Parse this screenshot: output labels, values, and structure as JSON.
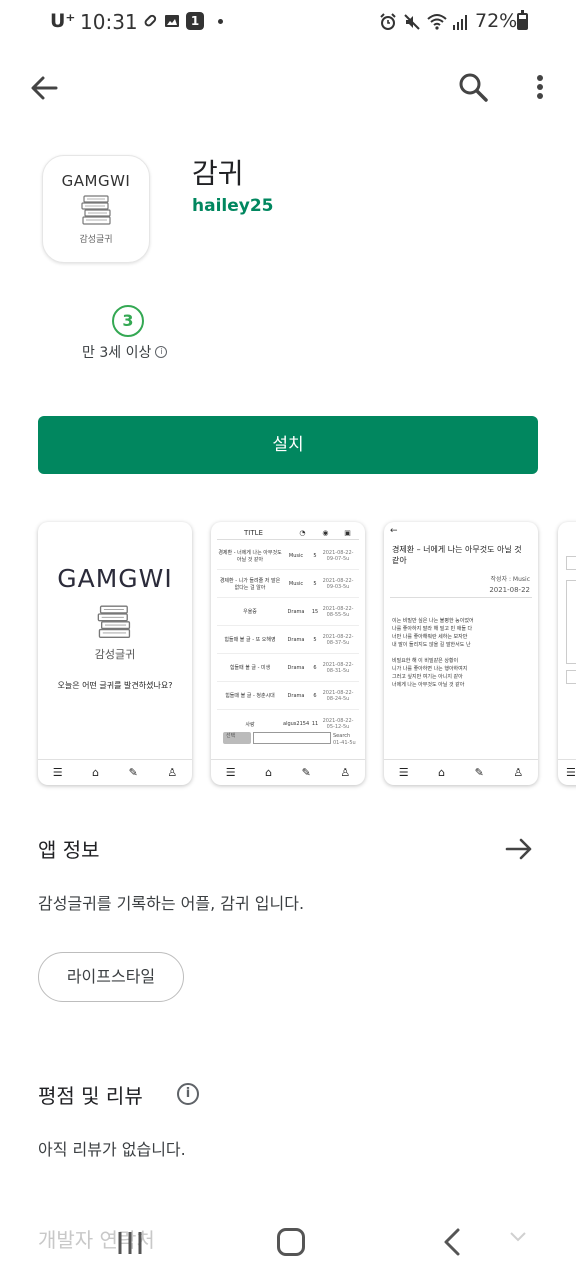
{
  "status_bar": {
    "carrier": "U⁺",
    "time": "10:31",
    "notification_count": "1",
    "battery": "72%",
    "battery_level": 0.72
  },
  "app": {
    "name": "감귀",
    "developer": "hailey25",
    "icon": {
      "title": "GAMGWI",
      "subtitle": "감성글귀"
    }
  },
  "rating": {
    "age_badge": "3",
    "age_label": "만 3세 이상"
  },
  "install_button": "설치",
  "screenshots": {
    "shot1": {
      "title": "GAMGWI",
      "subtitle": "감성글귀",
      "question": "오늘은 어떤 글귀를 발견하셨나요?"
    },
    "shot2": {
      "header_title": "TITLE",
      "rows": [
        {
          "title": "경제환 - 너에게 나는 아무것도 아닐 것 같아",
          "genre": "Music",
          "count": "5",
          "date": "2021-08-22-09-07-5u"
        },
        {
          "title": "경제환 - 니가 들려줄 저 말은 없다는 걸 알아",
          "genre": "Music",
          "count": "5",
          "date": "2021-08-22-09-03-5u"
        },
        {
          "title": "우울증",
          "genre": "Drama",
          "count": "15",
          "date": "2021-08-22-08-55-5u"
        },
        {
          "title": "힘들때 볼 글 - 또 오해영",
          "genre": "Drama",
          "count": "5",
          "date": "2021-08-22-08-37-5u"
        },
        {
          "title": "힘들때 볼 글 - 미생",
          "genre": "Drama",
          "count": "6",
          "date": "2021-08-22-08-31-5u"
        },
        {
          "title": "힘들때 볼 글 - 청춘시대",
          "genre": "Drama",
          "count": "6",
          "date": "2021-08-22-08-24-5u"
        },
        {
          "title": "사랑",
          "genre": "algus2154",
          "count": "11",
          "date": "2021-08-22-05-12-5u"
        }
      ],
      "search_select": "선택",
      "search_button": "Search",
      "search_meta": "01-41-5u"
    },
    "shot3": {
      "back": "←",
      "title": "경제환 – 너에게 나는 아무것도 아닐 것 같아",
      "author": "작성자 : Music",
      "date": "2021-08-22",
      "body": "이는 비밀만 싶은 나는 불평한 능이었어\n나를 좋아하지 말라 해 빌고 빈 애들 다\n너만 나를 좋아해줘란 세하는 보자만\n내 말이 들리지도 않을 길 말한서도 난\n\n비밀요한 해 이 비밀같은 상황이\n니가 나를 좋아하면 나는 행아하여지\n그러고 싶지만 여기는 아니지 같아\n너에게 나는 아무것도 아닐 것 같아"
    }
  },
  "about": {
    "title": "앱 정보",
    "description": "감성글귀를 기록하는 어플, 감귀 입니다.",
    "category": "라이프스타일"
  },
  "reviews": {
    "title": "평점 및 리뷰",
    "empty_text": "아직 리뷰가 없습니다."
  },
  "developer_contact": "개발자 연락처",
  "colors": {
    "accent": "#01875f",
    "age_badge": "#34a853"
  },
  "icons": {
    "back": "back-arrow-icon",
    "search": "search-icon",
    "more": "more-vert-icon",
    "about_arrow": "arrow-right-icon"
  }
}
